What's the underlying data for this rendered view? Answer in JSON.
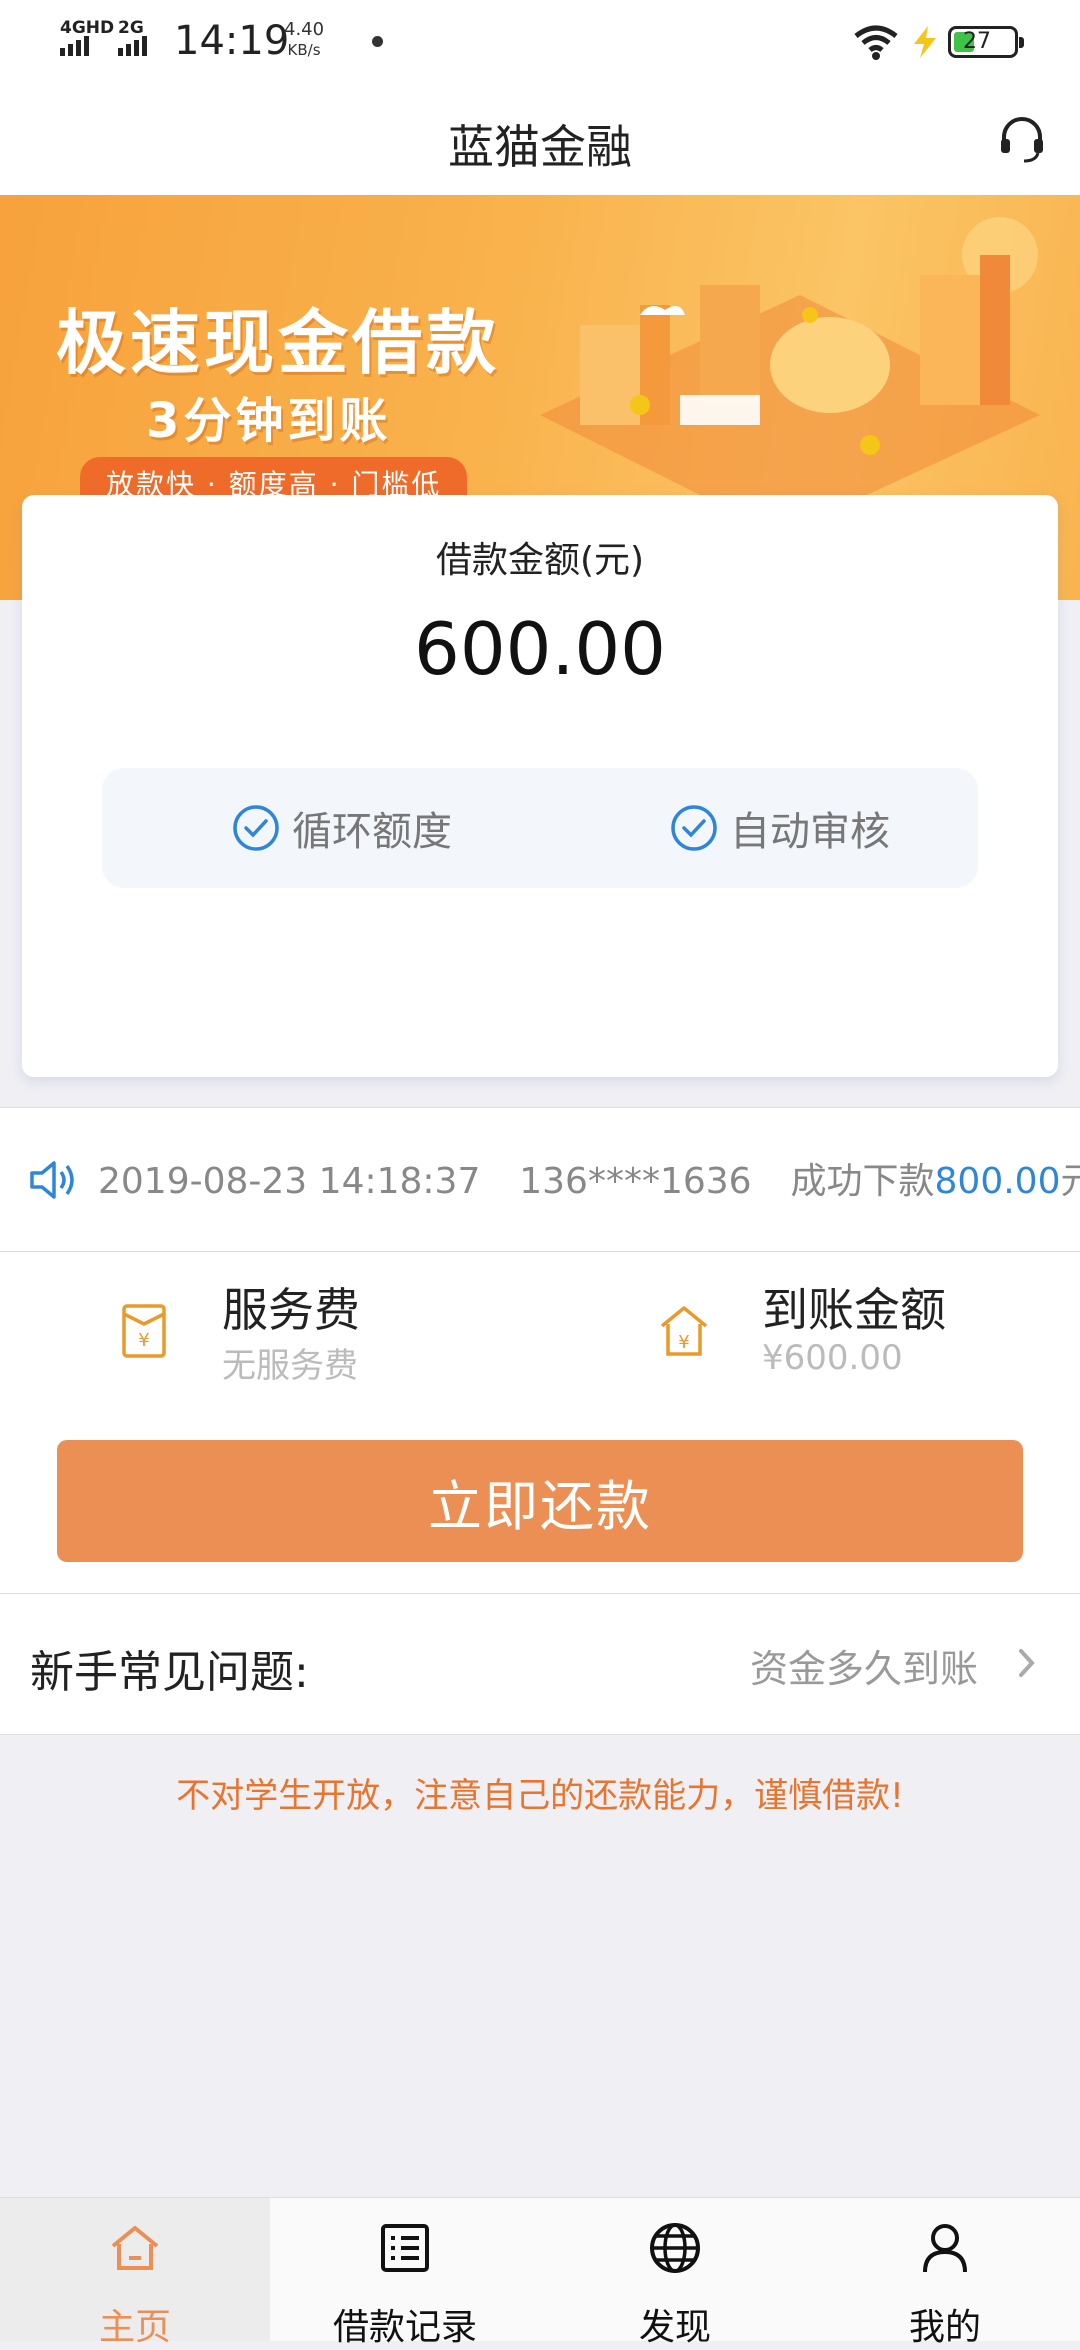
{
  "status_bar": {
    "network1": "4GHD",
    "network2": "2G",
    "time": "14:19",
    "speed_value": "4.40",
    "speed_unit": "KB/s",
    "battery": "27"
  },
  "header": {
    "title": "蓝猫金融"
  },
  "banner": {
    "headline": "极速现金借款",
    "subline": "3分钟到账",
    "tagline": "放款快 · 额度高 · 门槛低"
  },
  "loan_card": {
    "label": "借款金额(元)",
    "amount": "600.00",
    "features": [
      "循环额度",
      "自动审核"
    ]
  },
  "notice": {
    "date": "2019-08-23 14:18:37",
    "phone": "136****1636",
    "prefix": "成功下款",
    "amount": "800.00",
    "suffix": "元"
  },
  "fees": {
    "service_title": "服务费",
    "service_value": "无服务费",
    "arrival_title": "到账金额",
    "arrival_value": "¥600.00"
  },
  "action": {
    "repay_label": "立即还款"
  },
  "faq": {
    "title": "新手常见问题:",
    "link": "资金多久到账"
  },
  "warning": "不对学生开放，注意自己的还款能力，谨慎借款!",
  "tabs": [
    {
      "label": "主页",
      "icon": "home-icon",
      "active": true
    },
    {
      "label": "借款记录",
      "icon": "list-icon",
      "active": false
    },
    {
      "label": "发现",
      "icon": "globe-icon",
      "active": false
    },
    {
      "label": "我的",
      "icon": "user-icon",
      "active": false
    }
  ],
  "colors": {
    "accent": "#ec8f55",
    "link_blue": "#2f86d8",
    "warning": "#e8742d",
    "check_blue": "#2f86d8"
  }
}
